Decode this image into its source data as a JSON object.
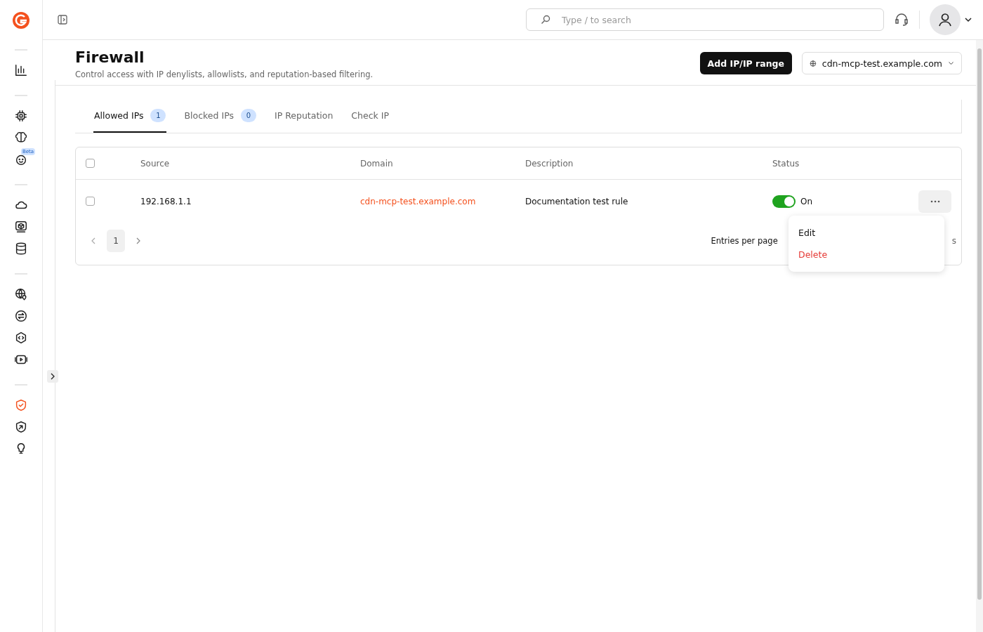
{
  "sidebar": {
    "groups": [
      [
        {
          "selected": false
        }
      ],
      [
        {
          "selected": false
        },
        {
          "selected": false
        },
        {
          "selected": false,
          "badge": "Beta"
        }
      ],
      [
        {
          "selected": false
        },
        {
          "selected": false
        },
        {
          "selected": false
        }
      ],
      [
        {
          "selected": false
        },
        {
          "selected": false
        },
        {
          "selected": false
        },
        {
          "selected": false
        }
      ],
      [
        {
          "selected": true
        },
        {
          "selected": false
        },
        {
          "selected": false
        }
      ]
    ]
  },
  "topbar": {
    "search": {
      "placeholder": "Type / to search"
    }
  },
  "page": {
    "title": "Firewall",
    "subtitle": "Control access with IP denylists, allowlists, and reputation-based filtering.",
    "add_button": "Add IP/IP range",
    "domain_select": "cdn-mcp-test.example.com"
  },
  "tabs": [
    {
      "label": "Allowed IPs",
      "count": "1",
      "selected": true
    },
    {
      "label": "Blocked IPs",
      "count": "0",
      "selected": false
    },
    {
      "label": "IP Reputation",
      "selected": false
    },
    {
      "label": "Check IP",
      "selected": false
    }
  ],
  "table": {
    "select_all_checked": false,
    "columns": [
      "Source",
      "Domain",
      "Description",
      "Status"
    ],
    "rows": [
      {
        "checked": false,
        "source": "192.168.1.1",
        "domain": "cdn-mcp-test.example.com",
        "description": "Documentation test rule",
        "on": true,
        "status": "On"
      }
    ]
  },
  "pagination": {
    "pages": [
      {
        "label": "1",
        "selected": true
      }
    ],
    "entries_label": "Entries per page",
    "entries_value_tail": "s"
  },
  "menu": {
    "items": [
      {
        "label": "Edit",
        "kind": "normal"
      },
      {
        "label": "Delete",
        "kind": "danger"
      }
    ]
  }
}
